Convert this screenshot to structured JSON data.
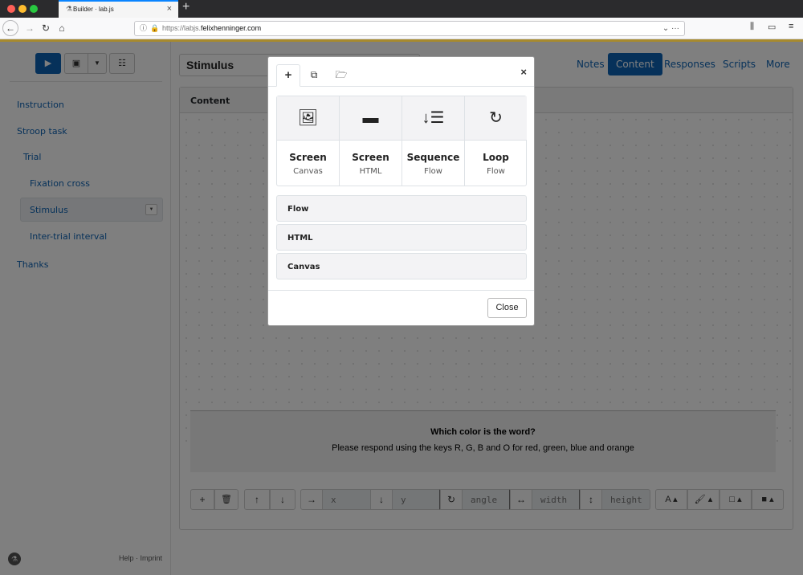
{
  "browser": {
    "tab_title": "Builder · lab.js",
    "url_prefix": "https://labjs.",
    "url_host": "felixhenninger.com"
  },
  "sidebar": {
    "items": [
      {
        "label": "Instruction"
      },
      {
        "label": "Stroop task"
      },
      {
        "label": "Trial"
      },
      {
        "label": "Fixation cross"
      },
      {
        "label": "Stimulus"
      },
      {
        "label": "Inter-trial interval"
      },
      {
        "label": "Thanks"
      }
    ],
    "footer": "Help · Imprint"
  },
  "main": {
    "title": "Stimulus",
    "nav": [
      {
        "label": "Notes"
      },
      {
        "label": "Content"
      },
      {
        "label": "Responses"
      },
      {
        "label": "Scripts"
      },
      {
        "label": "More"
      }
    ],
    "card_header": "Content",
    "stimulus_question": "Which color is the word?",
    "stimulus_instruction": "Please respond using the keys R, G, B and O for red, green, blue and orange",
    "toolbar": {
      "x_placeholder": "x",
      "y_placeholder": "y",
      "angle_placeholder": "angle",
      "width_placeholder": "width",
      "height_placeholder": "height"
    }
  },
  "modal": {
    "tiles": [
      {
        "label": "Screen",
        "sub": "Canvas",
        "icon": "image-icon"
      },
      {
        "label": "Screen",
        "sub": "HTML",
        "icon": "window-icon"
      },
      {
        "label": "Sequence",
        "sub": "Flow",
        "icon": "sort-amount-icon"
      },
      {
        "label": "Loop",
        "sub": "Flow",
        "icon": "redo-icon"
      }
    ],
    "list": [
      {
        "label": "Flow"
      },
      {
        "label": "HTML"
      },
      {
        "label": "Canvas"
      }
    ],
    "close_label": "Close"
  },
  "colors": {
    "accent": "#0d63b4",
    "gold": "#a78a2e"
  }
}
